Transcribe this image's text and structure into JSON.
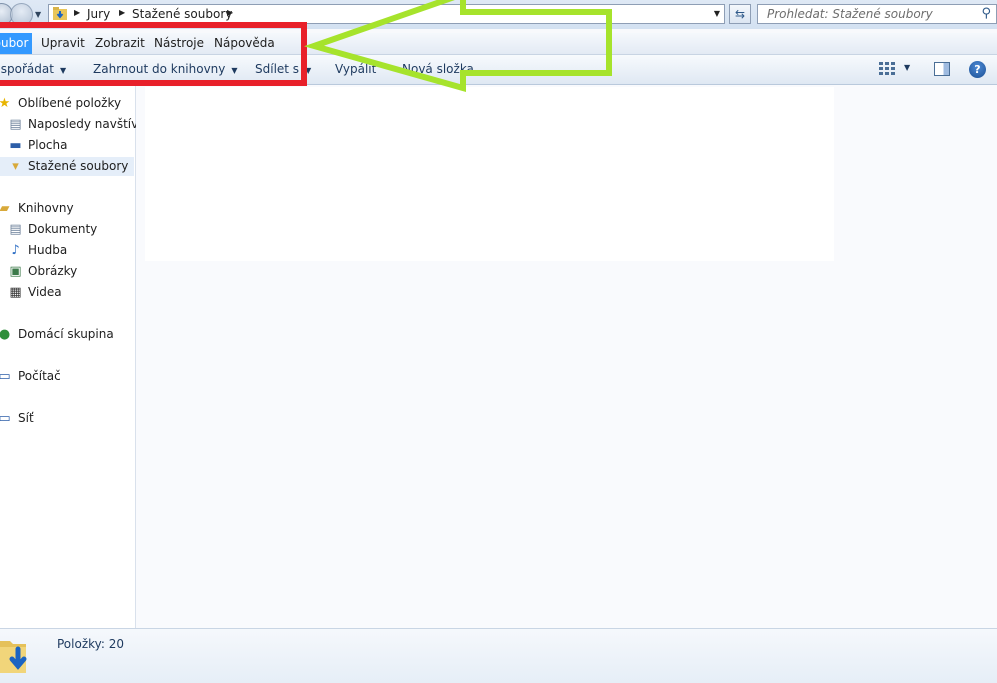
{
  "address_bar": {
    "breadcrumbs": [
      "Jury",
      "Stažené soubory"
    ],
    "search_placeholder": "Prohledat: Stažené soubory"
  },
  "menu": {
    "items": [
      "Soubor",
      "Upravit",
      "Zobrazit",
      "Nástroje",
      "Nápověda"
    ]
  },
  "commands": {
    "organize": "Uspořádat",
    "include_in_library": "Zahrnout do knihovny",
    "share": "Sdílet s",
    "burn": "Vypálit",
    "new_folder": "Nová složka"
  },
  "navigation": {
    "favorites": {
      "label": "Oblíbené položky",
      "items": [
        "Naposledy navštívené",
        "Plocha",
        "Stažené soubory"
      ]
    },
    "libraries": {
      "label": "Knihovny",
      "items": [
        "Dokumenty",
        "Hudba",
        "Obrázky",
        "Videa"
      ]
    },
    "homegroup": "Domácí skupina",
    "computer": "Počítač",
    "network": "Síť"
  },
  "details": {
    "items_count": "Položky: 20"
  },
  "colors": {
    "annotation_box": "#e8202a",
    "annotation_arrow": "#a6e32c",
    "menu_active": "#3399ff"
  },
  "icons": {
    "back": "back-arrow-icon",
    "forward": "forward-arrow-icon",
    "refresh": "refresh-icon",
    "search": "search-icon",
    "help": "help-icon"
  }
}
